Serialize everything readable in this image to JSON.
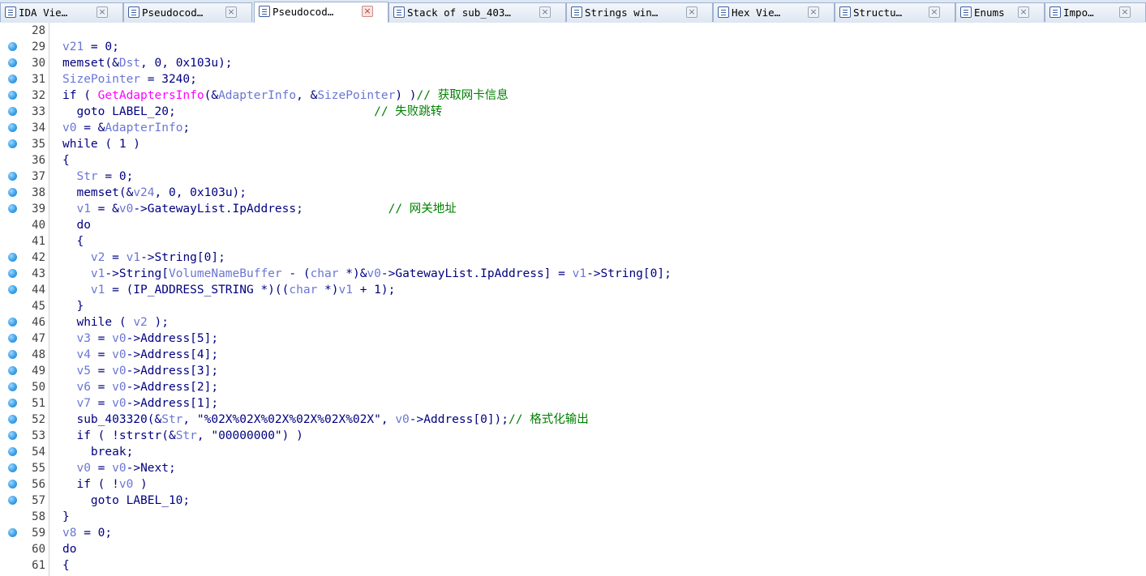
{
  "tabs": [
    {
      "label": "IDA Vie…",
      "icon": "ida-view-icon"
    },
    {
      "label": "Pseudocod…",
      "icon": "pseudocode-icon"
    },
    {
      "label": "Pseudocod…",
      "icon": "pseudocode-icon",
      "active": true
    },
    {
      "label": "Stack of sub_403…",
      "icon": "stack-icon"
    },
    {
      "label": "Strings win…",
      "icon": "strings-icon"
    },
    {
      "label": "Hex Vie…",
      "icon": "hex-view-icon"
    },
    {
      "label": "Structu…",
      "icon": "structures-icon"
    },
    {
      "label": "Enums",
      "icon": "enums-icon"
    },
    {
      "label": "Impo…",
      "icon": "imports-icon"
    }
  ],
  "close_glyph": "×",
  "colors": {
    "variable": "#6a76d4",
    "comment": "#008000",
    "import_function": "#ff00ff",
    "default": "#000080",
    "breakpoint_dot": "#3aa0e8"
  },
  "code_lines": [
    {
      "n": "28",
      "dot": false,
      "tokens": []
    },
    {
      "n": "29",
      "dot": true,
      "tokens": [
        [
          "v",
          "v21"
        ],
        [
          "t",
          " = 0;"
        ]
      ]
    },
    {
      "n": "30",
      "dot": true,
      "tokens": [
        [
          "t",
          "memset(&"
        ],
        [
          "v",
          "Dst"
        ],
        [
          "t",
          ", 0, 0x103u);"
        ]
      ]
    },
    {
      "n": "31",
      "dot": true,
      "tokens": [
        [
          "v",
          "SizePointer"
        ],
        [
          "t",
          " = 3240;"
        ]
      ]
    },
    {
      "n": "32",
      "dot": true,
      "tokens": [
        [
          "t",
          "if ( "
        ],
        [
          "f",
          "GetAdaptersInfo"
        ],
        [
          "t",
          "(&"
        ],
        [
          "v",
          "AdapterInfo"
        ],
        [
          "t",
          ", &"
        ],
        [
          "v",
          "SizePointer"
        ],
        [
          "t",
          ") )"
        ],
        [
          "c",
          "// 获取网卡信息"
        ]
      ]
    },
    {
      "n": "33",
      "dot": true,
      "tokens": [
        [
          "t",
          "  goto LABEL_20;                            "
        ],
        [
          "c",
          "// 失败跳转"
        ]
      ]
    },
    {
      "n": "34",
      "dot": true,
      "tokens": [
        [
          "v",
          "v0"
        ],
        [
          "t",
          " = &"
        ],
        [
          "v",
          "AdapterInfo"
        ],
        [
          "t",
          ";"
        ]
      ]
    },
    {
      "n": "35",
      "dot": true,
      "tokens": [
        [
          "t",
          "while ( 1 )"
        ]
      ]
    },
    {
      "n": "36",
      "dot": false,
      "tokens": [
        [
          "t",
          "{"
        ]
      ]
    },
    {
      "n": "37",
      "dot": true,
      "tokens": [
        [
          "t",
          "  "
        ],
        [
          "v",
          "Str"
        ],
        [
          "t",
          " = 0;"
        ]
      ]
    },
    {
      "n": "38",
      "dot": true,
      "tokens": [
        [
          "t",
          "  memset(&"
        ],
        [
          "v",
          "v24"
        ],
        [
          "t",
          ", 0, 0x103u);"
        ]
      ]
    },
    {
      "n": "39",
      "dot": true,
      "tokens": [
        [
          "t",
          "  "
        ],
        [
          "v",
          "v1"
        ],
        [
          "t",
          " = &"
        ],
        [
          "v",
          "v0"
        ],
        [
          "t",
          "->GatewayList.IpAddress;            "
        ],
        [
          "c",
          "// 网关地址"
        ]
      ]
    },
    {
      "n": "40",
      "dot": false,
      "tokens": [
        [
          "t",
          "  do"
        ]
      ]
    },
    {
      "n": "41",
      "dot": false,
      "tokens": [
        [
          "t",
          "  {"
        ]
      ]
    },
    {
      "n": "42",
      "dot": true,
      "tokens": [
        [
          "t",
          "    "
        ],
        [
          "v",
          "v2"
        ],
        [
          "t",
          " = "
        ],
        [
          "v",
          "v1"
        ],
        [
          "t",
          "->String[0];"
        ]
      ]
    },
    {
      "n": "43",
      "dot": true,
      "tokens": [
        [
          "t",
          "    "
        ],
        [
          "v",
          "v1"
        ],
        [
          "t",
          "->String["
        ],
        [
          "v",
          "VolumeNameBuffer"
        ],
        [
          "t",
          " - ("
        ],
        [
          "v",
          "char"
        ],
        [
          "t",
          " *)&"
        ],
        [
          "v",
          "v0"
        ],
        [
          "t",
          "->GatewayList.IpAddress] = "
        ],
        [
          "v",
          "v1"
        ],
        [
          "t",
          "->String[0];"
        ]
      ]
    },
    {
      "n": "44",
      "dot": true,
      "tokens": [
        [
          "t",
          "    "
        ],
        [
          "v",
          "v1"
        ],
        [
          "t",
          " = (IP_ADDRESS_STRING *)(("
        ],
        [
          "v",
          "char"
        ],
        [
          "t",
          " *)"
        ],
        [
          "v",
          "v1"
        ],
        [
          "t",
          " + 1);"
        ]
      ]
    },
    {
      "n": "45",
      "dot": false,
      "tokens": [
        [
          "t",
          "  }"
        ]
      ]
    },
    {
      "n": "46",
      "dot": true,
      "tokens": [
        [
          "t",
          "  while ( "
        ],
        [
          "v",
          "v2"
        ],
        [
          "t",
          " );"
        ]
      ]
    },
    {
      "n": "47",
      "dot": true,
      "tokens": [
        [
          "t",
          "  "
        ],
        [
          "v",
          "v3"
        ],
        [
          "t",
          " = "
        ],
        [
          "v",
          "v0"
        ],
        [
          "t",
          "->Address[5];"
        ]
      ]
    },
    {
      "n": "48",
      "dot": true,
      "tokens": [
        [
          "t",
          "  "
        ],
        [
          "v",
          "v4"
        ],
        [
          "t",
          " = "
        ],
        [
          "v",
          "v0"
        ],
        [
          "t",
          "->Address[4];"
        ]
      ]
    },
    {
      "n": "49",
      "dot": true,
      "tokens": [
        [
          "t",
          "  "
        ],
        [
          "v",
          "v5"
        ],
        [
          "t",
          " = "
        ],
        [
          "v",
          "v0"
        ],
        [
          "t",
          "->Address[3];"
        ]
      ]
    },
    {
      "n": "50",
      "dot": true,
      "tokens": [
        [
          "t",
          "  "
        ],
        [
          "v",
          "v6"
        ],
        [
          "t",
          " = "
        ],
        [
          "v",
          "v0"
        ],
        [
          "t",
          "->Address[2];"
        ]
      ]
    },
    {
      "n": "51",
      "dot": true,
      "tokens": [
        [
          "t",
          "  "
        ],
        [
          "v",
          "v7"
        ],
        [
          "t",
          " = "
        ],
        [
          "v",
          "v0"
        ],
        [
          "t",
          "->Address[1];"
        ]
      ]
    },
    {
      "n": "52",
      "dot": true,
      "tokens": [
        [
          "t",
          "  sub_403320(&"
        ],
        [
          "v",
          "Str"
        ],
        [
          "t",
          ", \"%02X%02X%02X%02X%02X%02X\", "
        ],
        [
          "v",
          "v0"
        ],
        [
          "t",
          "->Address[0]);"
        ],
        [
          "c",
          "// 格式化输出"
        ]
      ]
    },
    {
      "n": "53",
      "dot": true,
      "tokens": [
        [
          "t",
          "  if ( !strstr(&"
        ],
        [
          "v",
          "Str"
        ],
        [
          "t",
          ", \"00000000\") )"
        ]
      ]
    },
    {
      "n": "54",
      "dot": true,
      "tokens": [
        [
          "t",
          "    break;"
        ]
      ]
    },
    {
      "n": "55",
      "dot": true,
      "tokens": [
        [
          "t",
          "  "
        ],
        [
          "v",
          "v0"
        ],
        [
          "t",
          " = "
        ],
        [
          "v",
          "v0"
        ],
        [
          "t",
          "->Next;"
        ]
      ]
    },
    {
      "n": "56",
      "dot": true,
      "tokens": [
        [
          "t",
          "  if ( !"
        ],
        [
          "v",
          "v0"
        ],
        [
          "t",
          " )"
        ]
      ]
    },
    {
      "n": "57",
      "dot": true,
      "tokens": [
        [
          "t",
          "    goto LABEL_10;"
        ]
      ]
    },
    {
      "n": "58",
      "dot": false,
      "tokens": [
        [
          "t",
          "}"
        ]
      ]
    },
    {
      "n": "59",
      "dot": true,
      "tokens": [
        [
          "v",
          "v8"
        ],
        [
          "t",
          " = 0;"
        ]
      ]
    },
    {
      "n": "60",
      "dot": false,
      "tokens": [
        [
          "t",
          "do"
        ]
      ]
    },
    {
      "n": "61",
      "dot": false,
      "tokens": [
        [
          "t",
          "{"
        ]
      ]
    }
  ]
}
